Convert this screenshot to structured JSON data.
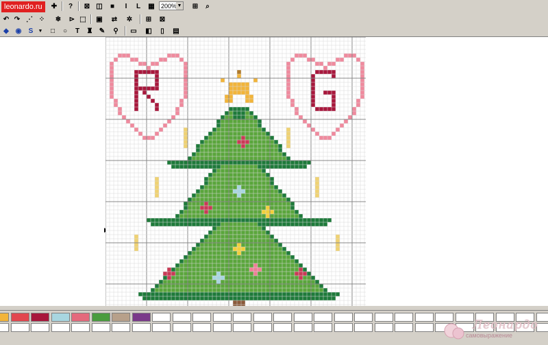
{
  "app": {
    "brand": "leonardo.ru",
    "zoom_value": "200%"
  },
  "watermark": {
    "title": "Леонардо",
    "subtitle": "самовыражение"
  },
  "pattern": {
    "monograms": [
      "R",
      "G"
    ],
    "grid_cell": 6
  },
  "palette": {
    "colors": [
      "#f2b43a",
      "#e2474f",
      "#a8173c",
      "#a8d6e0",
      "#e4697c",
      "#4a9c3e",
      "#b7a08a",
      "#7a3a8a"
    ]
  },
  "colors": {
    "tree_dark": "#1e7a3a",
    "tree_light": "#5aa63c",
    "star": "#f2b43a",
    "heart": "#f08a9e",
    "monogram": "#a8173c",
    "candle": "#f0d272",
    "ornament_red": "#c93a56",
    "ornament_blue": "#a8d6e0",
    "ornament_yellow": "#f2cf3a",
    "ornament_pink": "#ee7f96"
  }
}
